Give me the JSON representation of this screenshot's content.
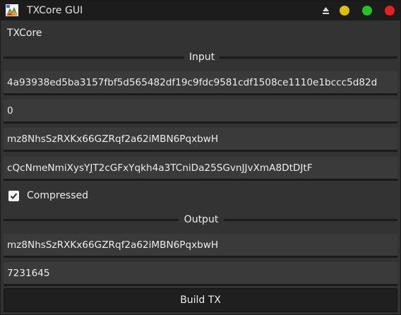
{
  "window": {
    "title": "TXCore GUI",
    "controls": {
      "minimize_color": "#e2c000",
      "maximize_color": "#22c422",
      "close_color": "#e82020"
    }
  },
  "header": {
    "label": "TXCore"
  },
  "input_section": {
    "label": "Input",
    "fields": [
      {
        "value": "4a93938ed5ba3157fbf5d565482df19c9fdc9581cdf1508ce1110e1bccc5d82d"
      },
      {
        "value": "0"
      },
      {
        "value": "mz8NhsSzRXKx66GZRqf2a62iMBN6PqxbwH"
      },
      {
        "value": "cQcNmeNmiXysYJT2cGFxYqkh4a3TCniDa25SGvnJJvXmA8DtDJtF"
      }
    ],
    "compressed": {
      "label": "Compressed",
      "checked": true
    }
  },
  "output_section": {
    "label": "Output",
    "fields": [
      {
        "value": "mz8NhsSzRXKx66GZRqf2a62iMBN6PqxbwH"
      },
      {
        "value": "7231645"
      }
    ]
  },
  "actions": {
    "build_label": "Build TX"
  }
}
